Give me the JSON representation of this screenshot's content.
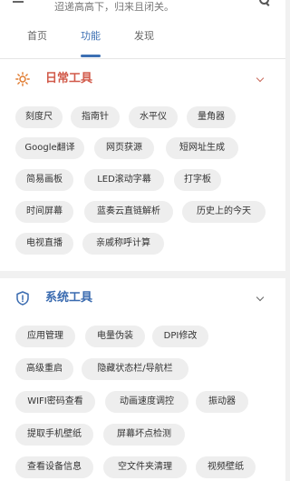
{
  "header": {
    "subtitle": "迢递高高下，归来且闭关。"
  },
  "tabs": [
    {
      "label": "首页"
    },
    {
      "label": "功能"
    },
    {
      "label": "发现"
    }
  ],
  "daily_tools": {
    "title": "日常工具",
    "accent_color": "#d15a4a",
    "items": [
      "刻度尺",
      "指南针",
      "水平仪",
      "量角器",
      "Google翻译",
      "网页获源",
      "短网址生成",
      "简易画板",
      "LED滚动字幕",
      "打字板",
      "时间屏幕",
      "蓝奏云直链解析",
      "历史上的今天",
      "电视直播",
      "亲戚称呼计算"
    ]
  },
  "system_tools": {
    "title": "系统工具",
    "accent_color": "#3a6bb0",
    "items": [
      "应用管理",
      "电量伪装",
      "DPI修改",
      "高级重启",
      "隐藏状态栏/导航栏",
      "WIFI密码查看",
      "动画速度调控",
      "振动器",
      "提取手机壁纸",
      "屏幕坏点检测",
      "查看设备信息",
      "空文件夹清理",
      "视频壁纸"
    ]
  }
}
